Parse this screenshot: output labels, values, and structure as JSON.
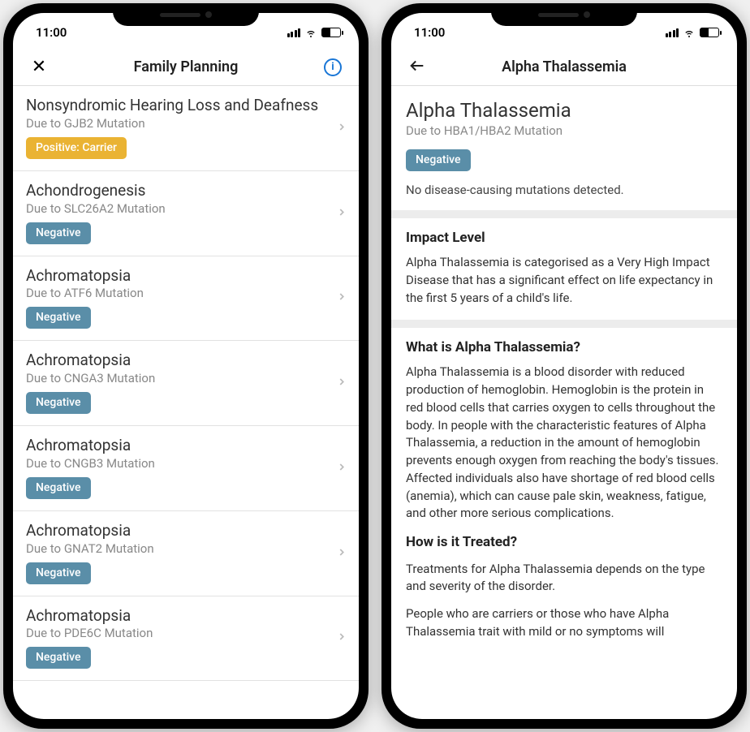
{
  "status": {
    "time": "11:00"
  },
  "left_screen": {
    "title": "Family Planning",
    "items": [
      {
        "title": "Nonsyndromic Hearing Loss and Deafness",
        "sub": "Due to GJB2 Mutation",
        "badge": "Positive: Carrier",
        "badge_type": "positive"
      },
      {
        "title": "Achondrogenesis",
        "sub": "Due to SLC26A2 Mutation",
        "badge": "Negative",
        "badge_type": "negative"
      },
      {
        "title": "Achromatopsia",
        "sub": "Due to ATF6 Mutation",
        "badge": "Negative",
        "badge_type": "negative"
      },
      {
        "title": "Achromatopsia",
        "sub": "Due to CNGA3 Mutation",
        "badge": "Negative",
        "badge_type": "negative"
      },
      {
        "title": "Achromatopsia",
        "sub": "Due to CNGB3 Mutation",
        "badge": "Negative",
        "badge_type": "negative"
      },
      {
        "title": "Achromatopsia",
        "sub": "Due to GNAT2 Mutation",
        "badge": "Negative",
        "badge_type": "negative"
      },
      {
        "title": "Achromatopsia",
        "sub": "Due to PDE6C Mutation",
        "badge": "Negative",
        "badge_type": "negative"
      }
    ]
  },
  "right_screen": {
    "title": "Alpha Thalassemia",
    "detail_title": "Alpha Thalassemia",
    "detail_sub": "Due to HBA1/HBA2 Mutation",
    "badge": "Negative",
    "summary": "No disease-causing mutations detected.",
    "impact_heading": "Impact Level",
    "impact_body": "Alpha Thalassemia is categorised as a Very High Impact Disease that has a significant effect on life expectancy in the first 5 years of a child's life.",
    "what_is_heading": "What is Alpha Thalassemia?",
    "what_is_body": "Alpha Thalassemia is a blood disorder with reduced production of hemoglobin. Hemoglobin is the protein in red blood cells that carries oxygen to cells throughout the body. In people with the characteristic features of Alpha Thalassemia, a reduction in the amount of hemoglobin prevents enough oxygen from reaching the body's tissues. Affected individuals also have shortage of red blood cells (anemia), which can cause pale skin, weakness, fatigue, and other more serious complications.",
    "treated_heading": "How is it Treated?",
    "treated_body_1": "Treatments for Alpha Thalassemia depends on the type and severity of the disorder.",
    "treated_body_2": "People who are carriers or those who have Alpha Thalassemia trait with mild or no symptoms will"
  }
}
